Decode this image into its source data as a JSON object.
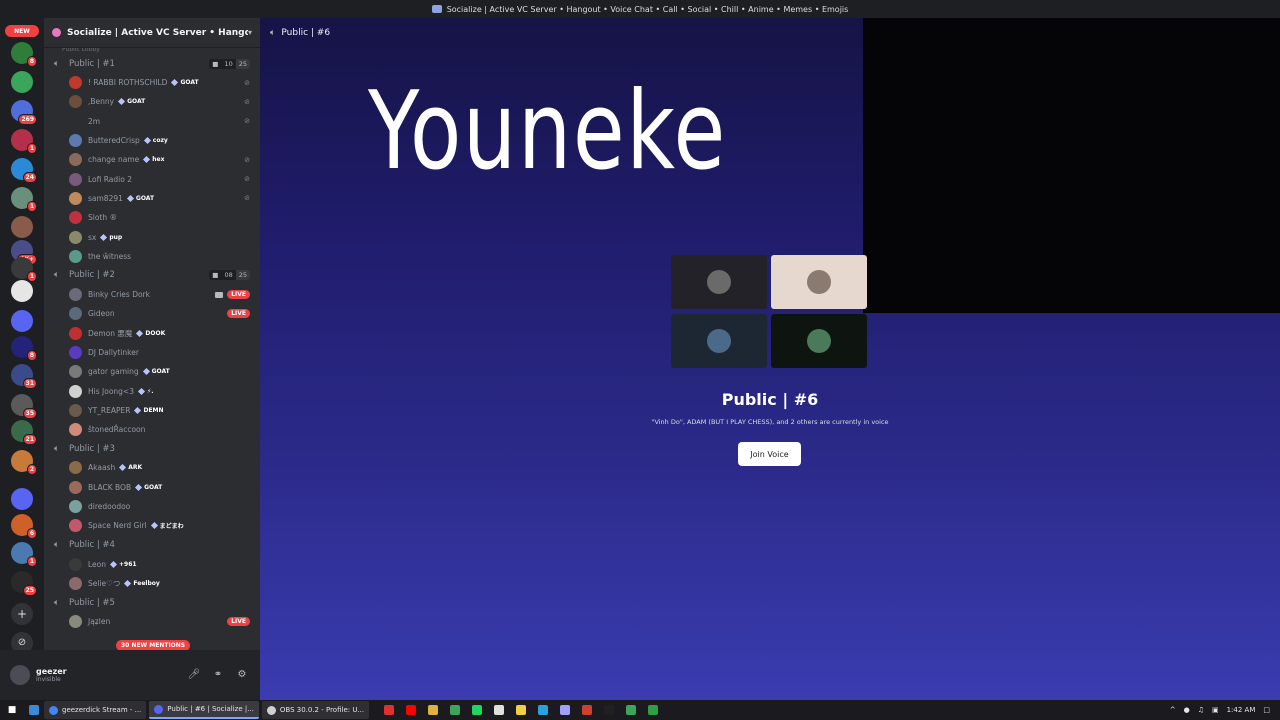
{
  "window_title": "Socialize | Active VC Server • Hangout • Voice Chat • Call • Social • Chill • Anime • Memes • Emojis",
  "rail": {
    "new_label": "NEW",
    "servers": [
      {
        "color": "#2f7d3a",
        "badge": "8"
      },
      {
        "color": "#3ba55c",
        "badge": ""
      },
      {
        "color": "#4f6ddb",
        "badge": "269"
      },
      {
        "color": "#b3304a",
        "badge": "1"
      },
      {
        "color": "#2b8ad8",
        "badge": "24"
      },
      {
        "color": "#6a8f7a",
        "badge": "1"
      },
      {
        "color": "#8a5a4a",
        "badge": ""
      },
      {
        "color": "#4b4d8a",
        "badge": "4K+"
      },
      {
        "color": "#3a3a3a",
        "badge": "1"
      },
      {
        "color": "#e6e6e6",
        "badge": ""
      },
      {
        "color": "#5865f2",
        "badge": ""
      },
      {
        "color": "#23237a",
        "badge": "8"
      },
      {
        "color": "#3b4a8a",
        "badge": "31"
      },
      {
        "color": "#5a5a5a",
        "badge": "35"
      },
      {
        "color": "#3a6a4a",
        "badge": "21"
      },
      {
        "color": "#c77a3a",
        "badge": "2"
      },
      {
        "color": "#5865f2",
        "badge": ""
      },
      {
        "color": "#d0602a",
        "badge": "6"
      },
      {
        "color": "#4a7ab0",
        "badge": "1"
      },
      {
        "color": "#2a2a2a",
        "badge": "25"
      }
    ],
    "add_icon": "+",
    "discover_icon": "⊘"
  },
  "server": {
    "name": "Socialize | Active VC Server • Hangout ..."
  },
  "channels": {
    "cut_label": "Public Lobby",
    "voice": [
      {
        "name": "Public | #1",
        "count_a": "10",
        "count_b": "25",
        "members": [
          {
            "name": "! RABBI ROTHSCHILD",
            "tag": "GOAT",
            "color": "#c0392b",
            "mic_off": true
          },
          {
            "name": ",Benny",
            "tag": "GOAT",
            "color": "#6b4f3a",
            "mic_off": true
          },
          {
            "name": "2m",
            "tag": "",
            "color": "#2b2d31",
            "mic_off": true
          },
          {
            "name": "ButteredCrisp",
            "tag": "cozy",
            "color": "#5a7ab0",
            "mic_off": false
          },
          {
            "name": "change name",
            "tag": "hex",
            "color": "#8a6a5a",
            "mic_off": true
          },
          {
            "name": "Lofi Radio 2",
            "tag": "",
            "color": "#7a5a7a",
            "mic_off": true
          },
          {
            "name": "sam8291",
            "tag": "GOAT",
            "color": "#c08a5a",
            "mic_off": true
          },
          {
            "name": "Sloth ®",
            "tag": "",
            "color": "#c03040",
            "mic_off": false
          },
          {
            "name": "sx",
            "tag": "pup",
            "color": "#8a8a6a",
            "mic_off": false
          },
          {
            "name": "the ŵitness",
            "tag": "",
            "color": "#5a9a8a",
            "mic_off": false
          }
        ]
      },
      {
        "name": "Public | #2",
        "count_a": "08",
        "count_b": "25",
        "members": [
          {
            "name": "Binky Cries Dork",
            "tag": "",
            "color": "#6a6a7a",
            "live": true,
            "cam": true
          },
          {
            "name": "Gideon",
            "tag": "",
            "color": "#5a6a7a",
            "live": true
          },
          {
            "name": "Demon 悪魔",
            "tag": "DOOK",
            "color": "#c03030"
          },
          {
            "name": "DJ Dallytinker",
            "tag": "",
            "color": "#5a3ac0"
          },
          {
            "name": "gator gaming",
            "tag": "GOAT",
            "color": "#7a7a7a"
          },
          {
            "name": "His Joong<3",
            "tag": "⚡.",
            "color": "#d0d0d0"
          },
          {
            "name": "YT_REAPER",
            "tag": "DEMN",
            "color": "#6a5a4a"
          },
          {
            "name": "štonedŘaccoon",
            "tag": "",
            "color": "#d08a7a"
          }
        ]
      },
      {
        "name": "Public | #3",
        "count_a": "",
        "count_b": "",
        "members": [
          {
            "name": "Akaash",
            "tag": "ARK",
            "color": "#8a6a4a"
          },
          {
            "name": "BLACK BOB",
            "tag": "GOAT",
            "color": "#9a6a5a"
          },
          {
            "name": "diredoodoo",
            "tag": "",
            "color": "#7aa0a0"
          },
          {
            "name": "Space Nerd Girl",
            "tag": "まどまわ",
            "color": "#c05a6a"
          }
        ]
      },
      {
        "name": "Public | #4",
        "count_a": "",
        "count_b": "",
        "members": [
          {
            "name": "Leon",
            "tag": "+961",
            "color": "#3a3a3a"
          },
          {
            "name": "Selie♡つ",
            "tag": "Feelboy",
            "color": "#8a6a6a"
          }
        ]
      },
      {
        "name": "Public | #5",
        "count_a": "",
        "count_b": "",
        "members": [
          {
            "name": "Jąʑlen",
            "tag": "",
            "color": "#8a8a7a",
            "live": true
          }
        ]
      }
    ],
    "mentions_label": "30 NEW MENTIONS",
    "live_label": "LIVE"
  },
  "user": {
    "name": "geezer",
    "status": "Invisible"
  },
  "main": {
    "channel_name": "Public | #6",
    "overlay_text": "Youneke",
    "room_title": "Public | #6",
    "room_sub": "\"Vinh Do\", ADAM (BUT I PLAY CHESS), and 2 others are currently in voice",
    "join_label": "Join Voice",
    "tiles": [
      {
        "bg": "#222228",
        "av": "#6a6a6a"
      },
      {
        "bg": "#e6d8cf",
        "av": "#8a7a70"
      },
      {
        "bg": "#1c2733",
        "av": "#4a6a8a"
      },
      {
        "bg": "#0e1410",
        "av": "#4a7a5a"
      }
    ]
  },
  "taskbar": {
    "tasks": [
      {
        "label": "geezerdick Stream - ...",
        "color": "#4285f4",
        "active": false
      },
      {
        "label": "Public | #6 | Socialize |...",
        "color": "#5865f2",
        "active": true
      },
      {
        "label": "OBS 30.0.2 - Profile: U...",
        "color": "#d0d0d0",
        "active": false
      }
    ],
    "tray_icons": [
      "#e03030",
      "#ff0000",
      "#e0b040",
      "#3ba55c",
      "#1ed760",
      "#e0e0e0",
      "#f0d040",
      "#2aa0e0",
      "#a0a0ff",
      "#d04030",
      "#202020",
      "#3ba55c",
      "#2ea043"
    ],
    "time": "1:42 AM"
  }
}
